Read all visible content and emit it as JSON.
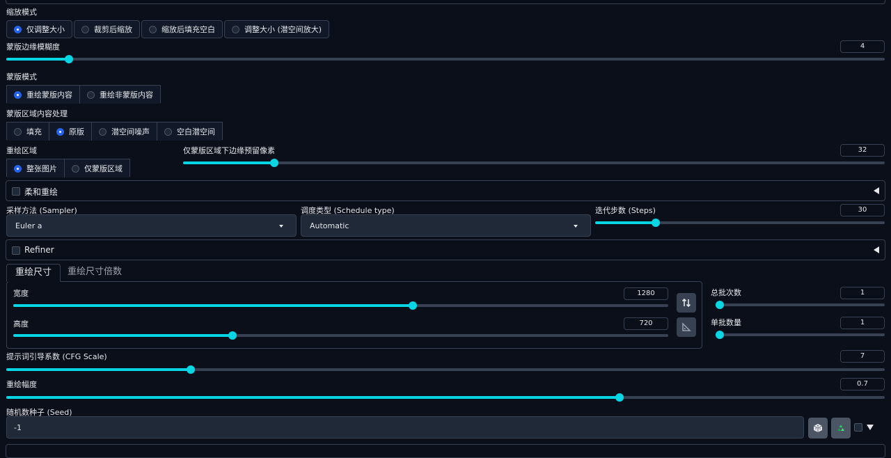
{
  "resize_mode": {
    "label": "缩放模式",
    "options": [
      "仅调整大小",
      "裁剪后缩放",
      "缩放后填充空白",
      "调整大小 (潜空间放大)"
    ],
    "selected": 0
  },
  "mask_blur": {
    "label": "蒙版边缘模糊度",
    "value": "4",
    "fraction": 0.067
  },
  "mask_mode": {
    "label": "蒙版模式",
    "options": [
      "重绘蒙版内容",
      "重绘非蒙版内容"
    ],
    "selected": 0
  },
  "masked_content": {
    "label": "蒙版区域内容处理",
    "options": [
      "填充",
      "原版",
      "潜空间噪声",
      "空白潜空间"
    ],
    "selected": 1
  },
  "inpaint_area": {
    "label": "重绘区域",
    "options": [
      "整张图片",
      "仅蒙版区域"
    ],
    "selected": 0
  },
  "only_masked_padding": {
    "label": "仅蒙版区域下边缘预留像素",
    "value": "32",
    "fraction": 0.125
  },
  "soft_inpaint": {
    "title": "柔和重绘"
  },
  "sampler": {
    "label": "采样方法 (Sampler)",
    "value": "Euler a"
  },
  "schedule": {
    "label": "调度类型 (Schedule type)",
    "value": "Automatic"
  },
  "steps": {
    "label": "迭代步数 (Steps)",
    "value": "30",
    "fraction": 0.2
  },
  "refiner": {
    "title": "Refiner"
  },
  "size_tabs": [
    "重绘尺寸",
    "重绘尺寸倍数"
  ],
  "width": {
    "label": "宽度",
    "value": "1280",
    "fraction": 0.611
  },
  "height": {
    "label": "高度",
    "value": "720",
    "fraction": 0.333
  },
  "batch_count": {
    "label": "总批次数",
    "value": "1",
    "fraction": 0.0
  },
  "batch_size": {
    "label": "单批数量",
    "value": "1",
    "fraction": 0.0
  },
  "cfg_scale": {
    "label": "提示词引导系数 (CFG Scale)",
    "value": "7",
    "fraction": 0.207
  },
  "denoising": {
    "label": "重绘幅度",
    "value": "0.7",
    "fraction": 0.7
  },
  "seed": {
    "label": "随机数种子 (Seed)",
    "value": "-1"
  },
  "colors": {
    "accent": "#06d6e3",
    "radio": "#2563eb",
    "background": "#0b0f19"
  }
}
